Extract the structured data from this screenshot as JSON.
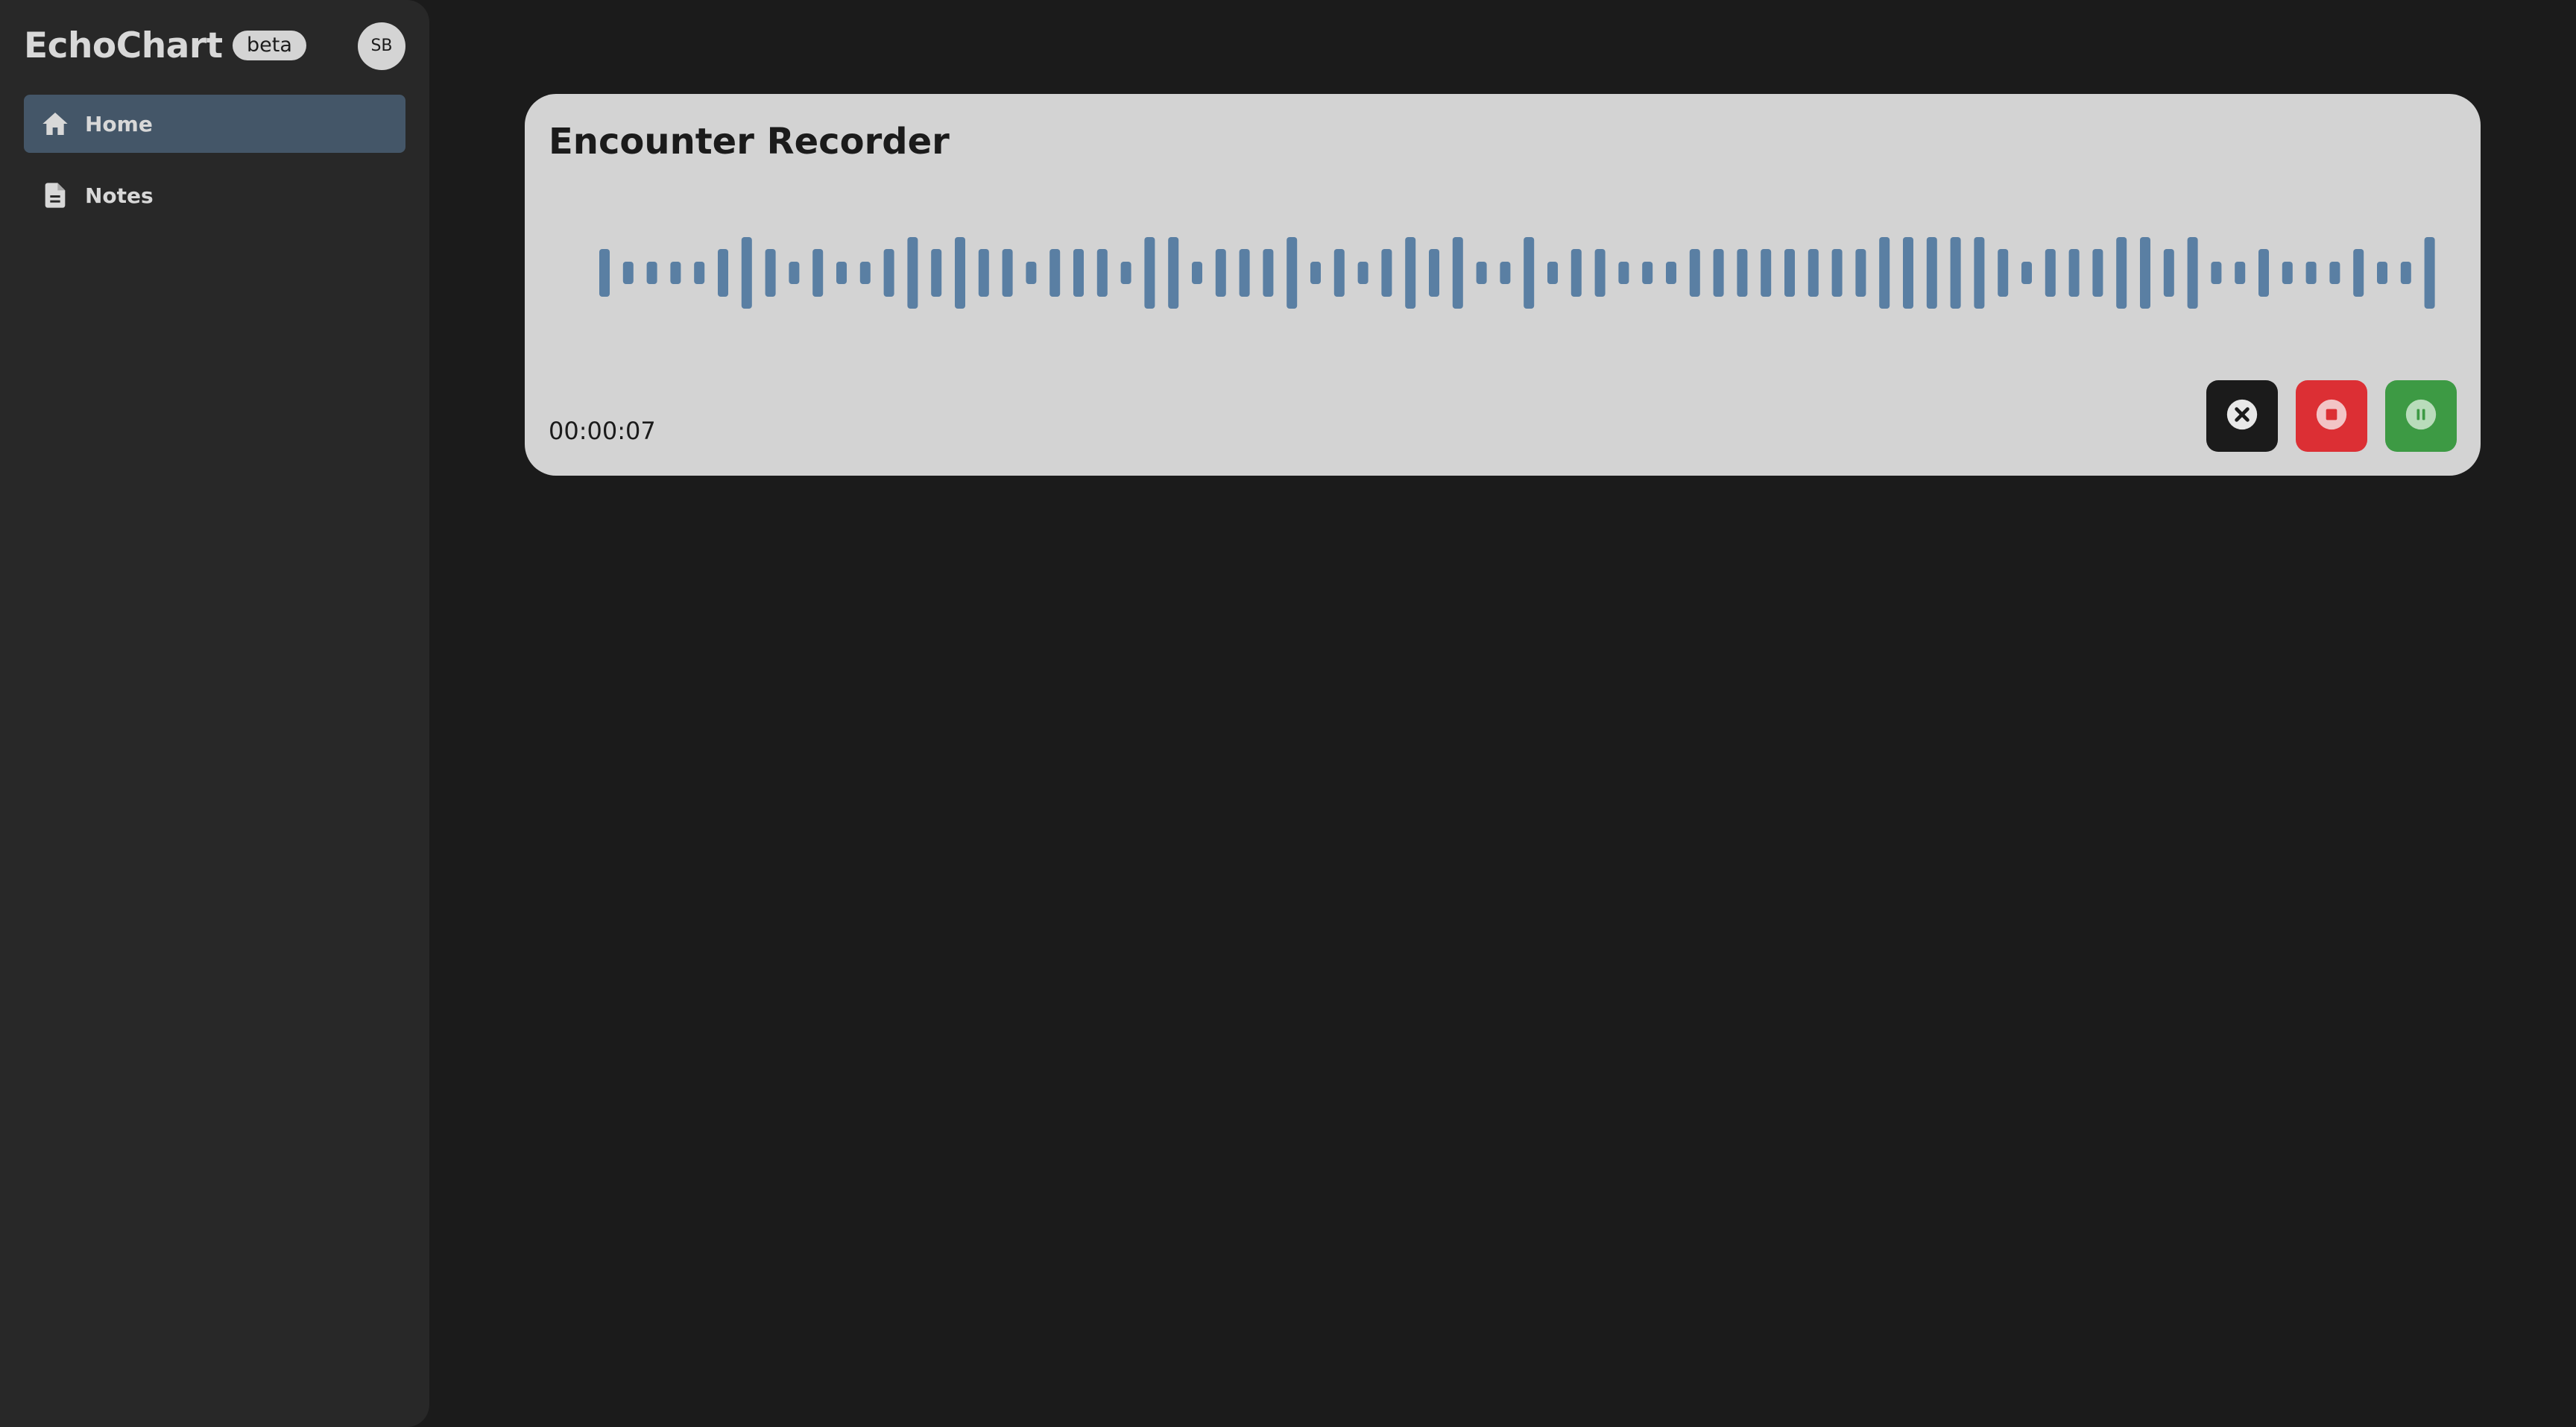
{
  "app": {
    "name": "EchoChart",
    "badge": "beta",
    "avatar_initials": "SB"
  },
  "sidebar": {
    "items": [
      {
        "label": "Home",
        "icon": "home-icon",
        "active": true
      },
      {
        "label": "Notes",
        "icon": "document-icon",
        "active": false
      }
    ]
  },
  "recorder": {
    "title": "Encounter Recorder",
    "elapsed": "00:00:07",
    "waveform_levels": [
      2,
      1,
      1,
      1,
      1,
      2,
      3,
      2,
      1,
      2,
      1,
      1,
      2,
      3,
      2,
      3,
      2,
      2,
      1,
      2,
      2,
      2,
      1,
      3,
      3,
      1,
      2,
      2,
      2,
      3,
      1,
      2,
      1,
      2,
      3,
      2,
      3,
      1,
      1,
      3,
      1,
      2,
      2,
      1,
      1,
      1,
      2,
      2,
      2,
      2,
      2,
      2,
      2,
      2,
      3,
      3,
      3,
      3,
      3,
      2,
      1,
      2,
      2,
      2,
      3,
      3,
      2,
      3,
      1,
      1,
      2,
      1,
      1,
      1,
      2,
      1,
      1,
      3
    ],
    "controls": {
      "cancel": {
        "icon": "close-circle-icon",
        "color": "#1b1b1b"
      },
      "stop": {
        "icon": "stop-circle-icon",
        "color": "#dc2f34"
      },
      "pause": {
        "icon": "pause-circle-icon",
        "color": "#3d9a44"
      }
    }
  },
  "colors": {
    "background": "#1b1b1b",
    "sidebar": "#282828",
    "active_nav": "#445668",
    "card": "#d3d3d3",
    "wave_bar": "#5a7fa3"
  }
}
